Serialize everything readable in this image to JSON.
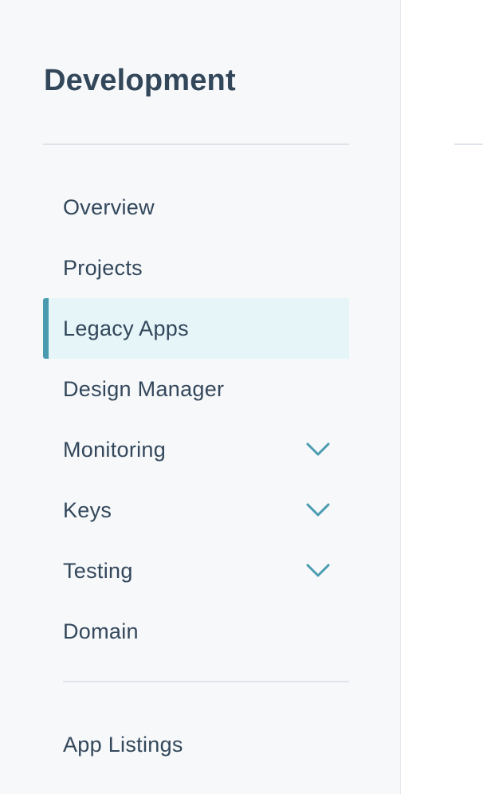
{
  "sidebar": {
    "title": "Development",
    "items": [
      {
        "label": "Overview",
        "active": false,
        "expandable": false
      },
      {
        "label": "Projects",
        "active": false,
        "expandable": false
      },
      {
        "label": "Legacy Apps",
        "active": true,
        "expandable": false
      },
      {
        "label": "Design Manager",
        "active": false,
        "expandable": false
      },
      {
        "label": "Monitoring",
        "active": false,
        "expandable": true,
        "icon": "chevron-down-icon"
      },
      {
        "label": "Keys",
        "active": false,
        "expandable": true,
        "icon": "chevron-down-icon"
      },
      {
        "label": "Testing",
        "active": false,
        "expandable": true,
        "icon": "chevron-down-icon"
      },
      {
        "label": "Domain",
        "active": false,
        "expandable": false
      }
    ],
    "footer_item": {
      "label": "App Listings"
    }
  },
  "colors": {
    "title_text": "#33475b",
    "item_text": "#33475b",
    "active_background": "#e5f5f8",
    "active_indicator": "#4a9bb0",
    "chevron": "#4a9bb0",
    "sidebar_background": "#f6f8fa",
    "divider": "#dfe3eb"
  }
}
